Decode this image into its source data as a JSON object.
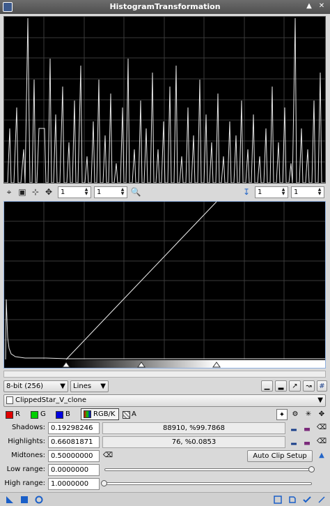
{
  "window": {
    "title": "HistogramTransformation"
  },
  "histogram_toolbar": {
    "zoom_h": "1",
    "zoom_v": "1",
    "zoom_h2": "1",
    "zoom_v2": "1"
  },
  "bit_depth": {
    "selected": "8-bit (256)"
  },
  "graph_style": {
    "selected": "Lines"
  },
  "view": {
    "selected": "ClippedStar_V_clone"
  },
  "channels": {
    "r": "R",
    "g": "G",
    "b": "B",
    "rgbk": "RGB/K",
    "a": "A",
    "colors": {
      "r": "#e00000",
      "g": "#00d000",
      "b": "#0000e0"
    }
  },
  "params": {
    "shadows_label": "Shadows:",
    "shadows_value": "0.19298246",
    "shadows_readout": "88910, %99.7868",
    "highlights_label": "Highlights:",
    "highlights_value": "0.66081871",
    "highlights_readout": "76, %0.0853",
    "midtones_label": "Midtones:",
    "midtones_value": "0.50000000",
    "auto_clip_label": "Auto Clip Setup",
    "low_range_label": "Low range:",
    "low_range_value": "0.0000000",
    "high_range_label": "High range:",
    "high_range_value": "1.0000000",
    "low_range_slider": 1.0,
    "high_range_slider": 0.0
  },
  "icons": {
    "title_icon": "histogram-app-icon",
    "minimize": "collapse-icon",
    "close": "close-icon"
  }
}
